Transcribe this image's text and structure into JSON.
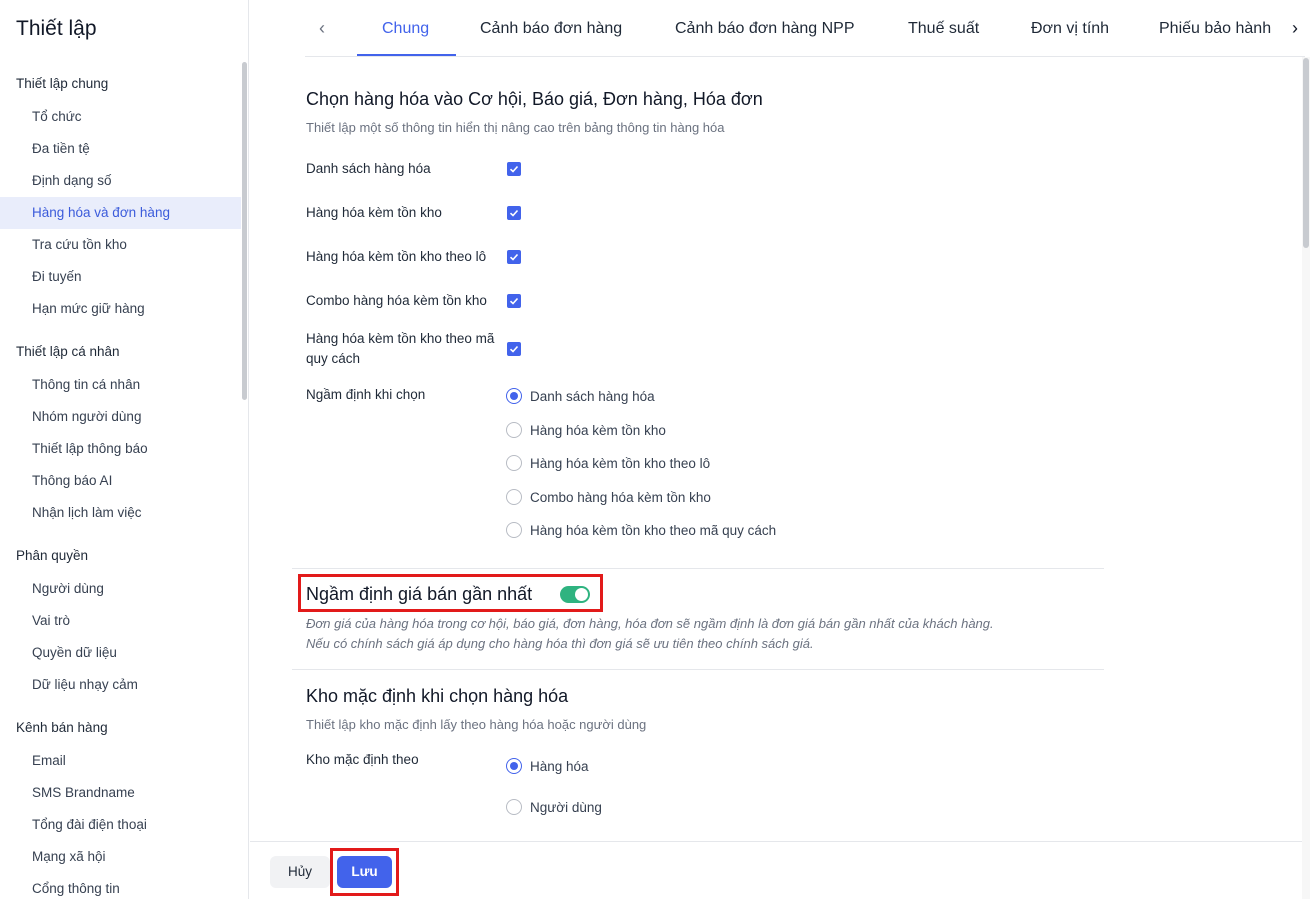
{
  "sidebar": {
    "title": "Thiết lập",
    "groups": [
      {
        "label": "Thiết lập chung",
        "items": [
          "Tổ chức",
          "Đa tiền tệ",
          "Định dạng số",
          "Hàng hóa và đơn hàng",
          "Tra cứu tồn kho",
          "Đi tuyến",
          "Hạn mức giữ hàng"
        ]
      },
      {
        "label": "Thiết lập cá nhân",
        "items": [
          "Thông tin cá nhân",
          "Nhóm người dùng",
          "Thiết lập thông báo",
          "Thông báo AI",
          "Nhận lịch làm việc"
        ]
      },
      {
        "label": "Phân quyền",
        "items": [
          "Người dùng",
          "Vai trò",
          "Quyền dữ liệu",
          "Dữ liệu nhạy cảm"
        ]
      },
      {
        "label": "Kênh bán hàng",
        "items": [
          "Email",
          "SMS Brandname",
          "Tổng đài điện thoại",
          "Mạng xã hội",
          "Cổng thông tin"
        ]
      }
    ],
    "active_item": "Hàng hóa và đơn hàng"
  },
  "tabs": {
    "items": [
      "Chung",
      "Cảnh báo đơn hàng",
      "Cảnh báo đơn hàng NPP",
      "Thuế suất",
      "Đơn vị tính",
      "Phiếu bảo hành"
    ],
    "active": "Chung",
    "prev_icon": "chevron-left-icon",
    "next_icon": "chevron-right-icon"
  },
  "product_select": {
    "title": "Chọn hàng hóa vào Cơ hội, Báo giá, Đơn hàng, Hóa đơn",
    "description": "Thiết lập một số thông tin hiển thị nâng cao trên bảng thông tin hàng hóa",
    "checkboxes": [
      {
        "label": "Danh sách hàng hóa",
        "checked": true
      },
      {
        "label": "Hàng hóa kèm tồn kho",
        "checked": true
      },
      {
        "label": "Hàng hóa kèm tồn kho theo lô",
        "checked": true
      },
      {
        "label": "Combo hàng hóa kèm tồn kho",
        "checked": true
      },
      {
        "label": "Hàng hóa kèm tồn kho theo mã quy cách",
        "checked": true
      }
    ],
    "default_label": "Ngầm định khi chọn",
    "default_options": [
      "Danh sách hàng hóa",
      "Hàng hóa kèm tồn kho",
      "Hàng hóa kèm tồn kho theo lô",
      "Combo hàng hóa kèm tồn kho",
      "Hàng hóa kèm tồn kho theo mã quy cách"
    ],
    "default_selected": "Danh sách hàng hóa"
  },
  "latest_price": {
    "title": "Ngầm định giá bán gần nhất",
    "enabled": true,
    "description": "Đơn giá của hàng hóa trong cơ hội, báo giá, đơn hàng, hóa đơn sẽ ngầm định là đơn giá bán gần nhất của khách hàng.",
    "note": "Nếu có chính sách giá áp dụng cho hàng hóa thì đơn giá sẽ ưu tiên theo chính sách giá."
  },
  "default_warehouse": {
    "title": "Kho mặc định khi chọn hàng hóa",
    "description": "Thiết lập kho mặc định lấy theo hàng hóa hoặc người dùng",
    "label": "Kho mặc định theo",
    "options": [
      "Hàng hóa",
      "Người dùng"
    ],
    "selected": "Hàng hóa"
  },
  "footer": {
    "cancel_label": "Hủy",
    "save_label": "Lưu"
  },
  "colors": {
    "accent": "#4263eb",
    "toggle_on": "#2fb380",
    "highlight": "#e21a1a"
  }
}
